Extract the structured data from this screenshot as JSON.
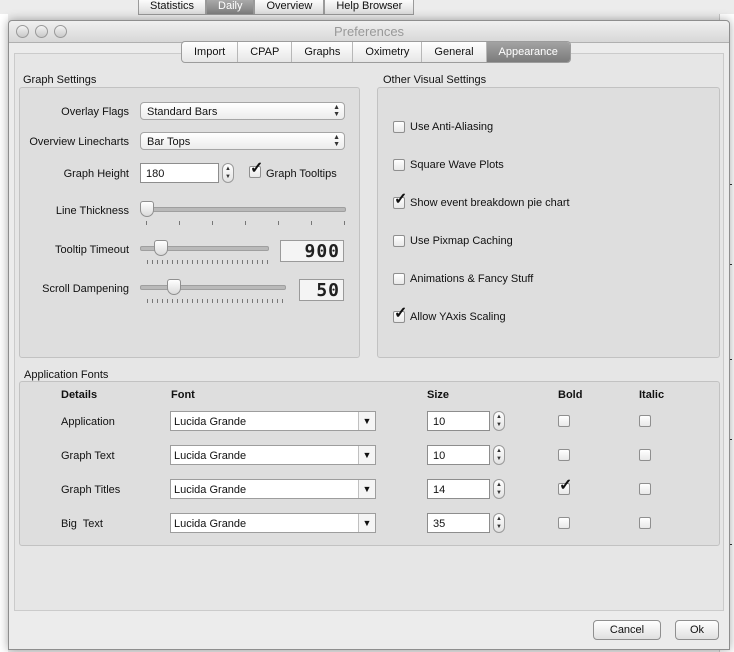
{
  "background_tabs": [
    "Statistics",
    "Daily",
    "Overview",
    "Help Browser"
  ],
  "background_active_tab": "Daily",
  "window": {
    "title": "Preferences"
  },
  "tabs": [
    "Import",
    "CPAP",
    "Graphs",
    "Oximetry",
    "General",
    "Appearance"
  ],
  "active_tab": "Appearance",
  "graph_settings": {
    "title": "Graph Settings",
    "overlay_flags": {
      "label": "Overlay Flags",
      "value": "Standard Bars"
    },
    "overview_linecharts": {
      "label": "Overview Linecharts",
      "value": "Bar Tops"
    },
    "graph_height": {
      "label": "Graph Height",
      "value": "180"
    },
    "graph_tooltips": {
      "label": "Graph Tooltips",
      "checked": true
    },
    "line_thickness": {
      "label": "Line Thickness",
      "level": 0.0
    },
    "tooltip_timeout": {
      "label": "Tooltip Timeout",
      "value": "900",
      "level": 0.12
    },
    "scroll_dampening": {
      "label": "Scroll Dampening",
      "value": "50",
      "level": 0.22
    }
  },
  "other_visual": {
    "title": "Other Visual Settings",
    "options": [
      {
        "label": "Use Anti-Aliasing",
        "checked": false
      },
      {
        "label": "Square Wave Plots",
        "checked": false
      },
      {
        "label": "Show event breakdown pie chart",
        "checked": true
      },
      {
        "label": "Use Pixmap Caching",
        "checked": false
      },
      {
        "label": "Animations & Fancy Stuff",
        "checked": false
      },
      {
        "label": "Allow YAxis Scaling",
        "checked": true
      }
    ]
  },
  "app_fonts": {
    "title": "Application Fonts",
    "headers": {
      "details": "Details",
      "font": "Font",
      "size": "Size",
      "bold": "Bold",
      "italic": "Italic"
    },
    "rows": [
      {
        "label": "Application",
        "font": "Lucida Grande",
        "size": "10",
        "bold": false,
        "italic": false
      },
      {
        "label": "Graph Text",
        "font": "Lucida Grande",
        "size": "10",
        "bold": false,
        "italic": false
      },
      {
        "label": "Graph Titles",
        "font": "Lucida Grande",
        "size": "14",
        "bold": true,
        "italic": false
      },
      {
        "label": "Big  Text",
        "font": "Lucida Grande",
        "size": "35",
        "bold": false,
        "italic": false
      }
    ]
  },
  "buttons": {
    "cancel": "Cancel",
    "ok": "Ok"
  }
}
